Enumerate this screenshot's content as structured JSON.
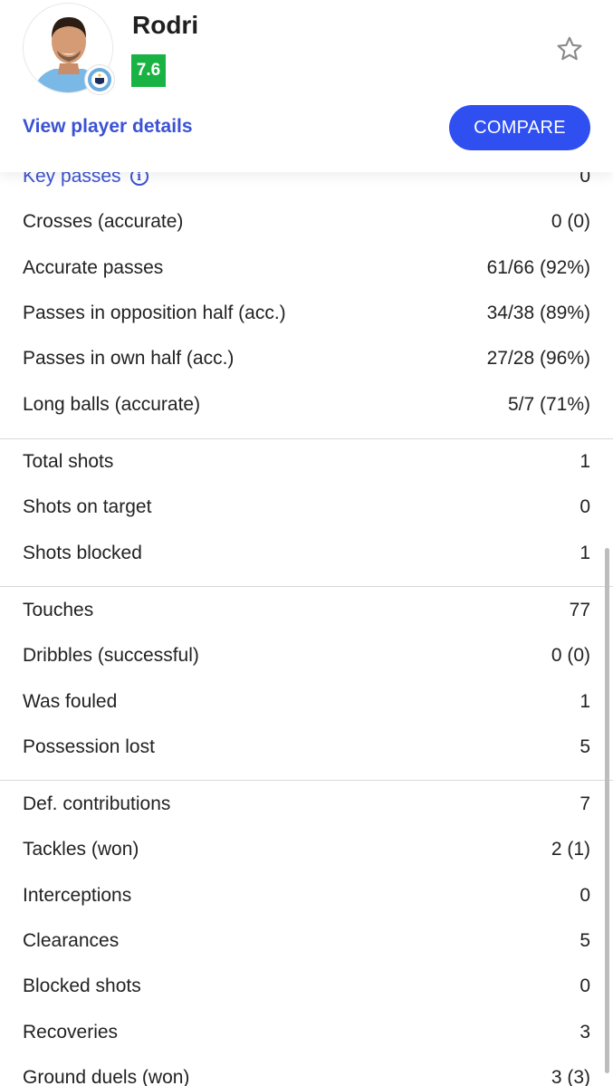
{
  "player": {
    "name": "Rodri",
    "rating": "7.6",
    "details_link": "View player details",
    "compare_label": "COMPARE"
  },
  "colors": {
    "rating_bg": "#19b343",
    "accent_blue": "#2f4ff0",
    "link_blue": "#3b52d4"
  },
  "icons": {
    "favorite": "star-outline-icon",
    "info": "info-icon",
    "club": "manchester-city-badge-icon"
  },
  "stats": {
    "passing": [
      {
        "label": "Key passes",
        "value": "0",
        "info": true
      },
      {
        "label": "Crosses (accurate)",
        "value": "0 (0)"
      },
      {
        "label": "Accurate passes",
        "value": "61/66 (92%)"
      },
      {
        "label": "Passes in opposition half (acc.)",
        "value": "34/38 (89%)"
      },
      {
        "label": "Passes in own half (acc.)",
        "value": "27/28 (96%)"
      },
      {
        "label": "Long balls (accurate)",
        "value": "5/7 (71%)"
      }
    ],
    "shooting": [
      {
        "label": "Total shots",
        "value": "1"
      },
      {
        "label": "Shots on target",
        "value": "0"
      },
      {
        "label": "Shots blocked",
        "value": "1"
      }
    ],
    "possession": [
      {
        "label": "Touches",
        "value": "77"
      },
      {
        "label": "Dribbles (successful)",
        "value": "0 (0)"
      },
      {
        "label": "Was fouled",
        "value": "1"
      },
      {
        "label": "Possession lost",
        "value": "5"
      }
    ],
    "defending": [
      {
        "label": "Def. contributions",
        "value": "7"
      },
      {
        "label": "Tackles (won)",
        "value": "2 (1)"
      },
      {
        "label": "Interceptions",
        "value": "0"
      },
      {
        "label": "Clearances",
        "value": "5"
      },
      {
        "label": "Blocked shots",
        "value": "0"
      },
      {
        "label": "Recoveries",
        "value": "3"
      },
      {
        "label": "Ground duels (won)",
        "value": "3 (3)"
      }
    ]
  }
}
